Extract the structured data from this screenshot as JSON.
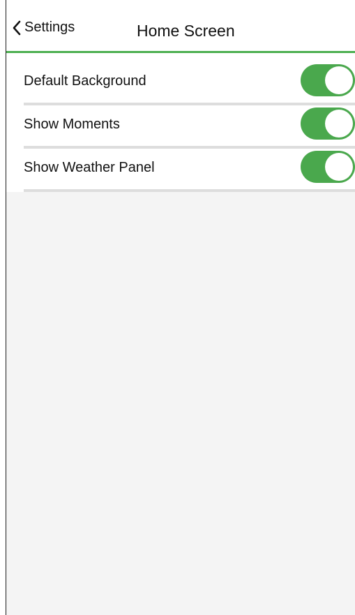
{
  "header": {
    "back_label": "Settings",
    "title": "Home Screen",
    "back_icon": "chevron-left-icon",
    "accent_color": "#4caf50"
  },
  "settings": [
    {
      "label": "Default Background",
      "enabled": true
    },
    {
      "label": "Show Moments",
      "enabled": true
    },
    {
      "label": "Show Weather Panel",
      "enabled": true
    }
  ],
  "colors": {
    "toggle_on": "#4aa84d",
    "background": "#f4f4f4",
    "divider": "#dddddd"
  }
}
